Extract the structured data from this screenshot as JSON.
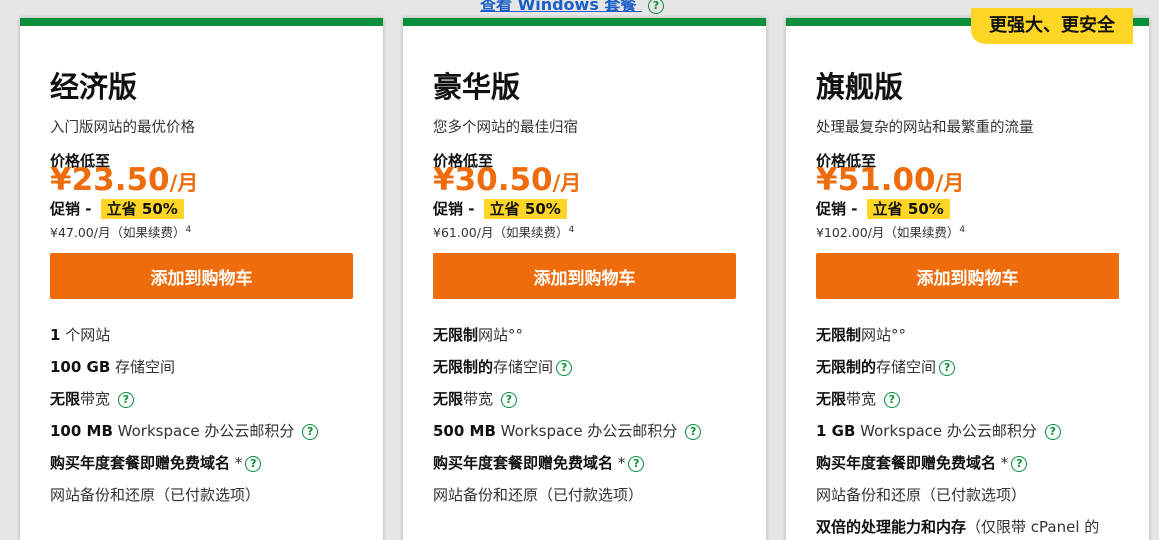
{
  "top_link": {
    "label": "查看 Windows 套餐"
  },
  "plans": [
    {
      "title": "经济版",
      "subtitle": "入门版网站的最优价格",
      "price_label": "价格低至",
      "price": "¥23.50",
      "per": "/月",
      "promo_label": "促销 - ",
      "promo_value": "立省 50%",
      "renew": "¥47.00/月（如果续费）",
      "renew_note": "4",
      "cart_button": "添加到购物车",
      "features": [
        {
          "bold": "1",
          "text": " 个网站",
          "help": false
        },
        {
          "bold": "100 GB",
          "text": " 存储空间",
          "help": false
        },
        {
          "bold": "无限",
          "text": "带宽 ",
          "help": true
        },
        {
          "bold": "100 MB",
          "text": " Workspace 办公云邮积分 ",
          "help": true
        },
        {
          "bold": "购买年度套餐即赠免费域名",
          "text": " *",
          "help": true
        },
        {
          "bold": "",
          "text": "网站备份和还原（已付款选项）",
          "help": false
        }
      ]
    },
    {
      "title": "豪华版",
      "subtitle": "您多个网站的最佳归宿",
      "price_label": "价格低至",
      "price": "¥30.50",
      "per": "/月",
      "promo_label": "促销 - ",
      "promo_value": "立省 50%",
      "renew": "¥61.00/月（如果续费）",
      "renew_note": "4",
      "cart_button": "添加到购物车",
      "features": [
        {
          "bold": "无限制",
          "text": "网站°°",
          "help": false
        },
        {
          "bold": "无限制的",
          "text": "存储空间",
          "help": true
        },
        {
          "bold": "无限",
          "text": "带宽 ",
          "help": true
        },
        {
          "bold": "500 MB",
          "text": " Workspace 办公云邮积分 ",
          "help": true
        },
        {
          "bold": "购买年度套餐即赠免费域名",
          "text": " *",
          "help": true
        },
        {
          "bold": "",
          "text": "网站备份和还原（已付款选项）",
          "help": false
        }
      ]
    },
    {
      "badge": "更强大、更安全",
      "title": "旗舰版",
      "subtitle": "处理最复杂的网站和最繁重的流量",
      "price_label": "价格低至",
      "price": "¥51.00",
      "per": "/月",
      "promo_label": "促销 - ",
      "promo_value": "立省 50%",
      "renew": "¥102.00/月（如果续费）",
      "renew_note": "4",
      "cart_button": "添加到购物车",
      "features": [
        {
          "bold": "无限制",
          "text": "网站°°",
          "help": false
        },
        {
          "bold": "无限制的",
          "text": "存储空间",
          "help": true
        },
        {
          "bold": "无限",
          "text": "带宽 ",
          "help": true
        },
        {
          "bold": "1 GB",
          "text": " Workspace 办公云邮积分 ",
          "help": true
        },
        {
          "bold": "购买年度套餐即赠免费域名",
          "text": " *",
          "help": true
        },
        {
          "bold": "",
          "text": "网站备份和还原（已付款选项）",
          "help": false
        },
        {
          "bold": "双倍的处理能力和内存",
          "text": "（仅限带 cPanel 的",
          "help": false
        }
      ]
    }
  ],
  "colors": {
    "accent": "#ef6c0c",
    "green": "#0a8f3b",
    "highlight": "#ffd626"
  },
  "icons": {
    "help": "question-circle-icon"
  }
}
